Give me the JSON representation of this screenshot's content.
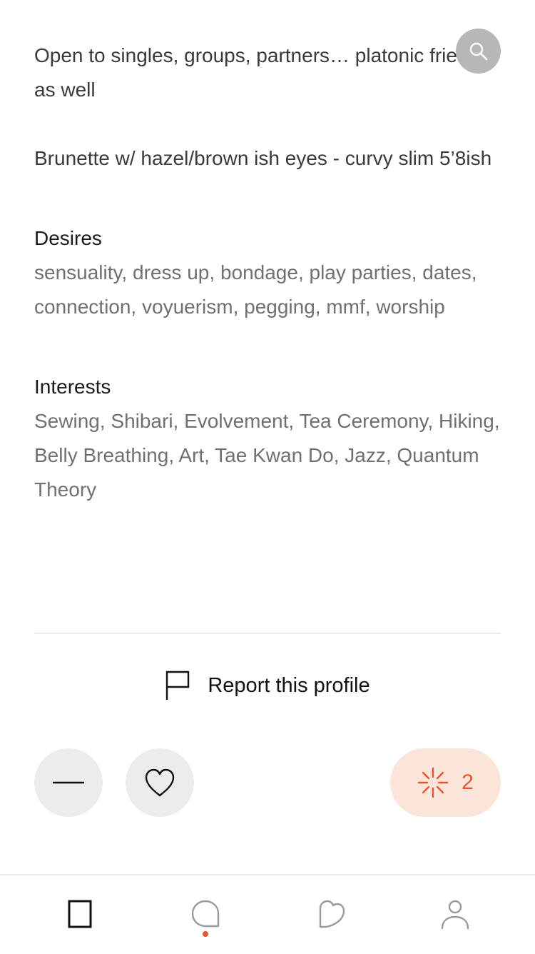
{
  "profile": {
    "bio_lines": [
      "Open to singles, groups, partners… platonic friends as well",
      "Brunette w/ hazel/brown ish eyes - curvy slim 5’8ish"
    ],
    "desires": {
      "title": "Desires",
      "text": "sensuality, dress up, bondage, play parties, dates, connection, voyuerism, pegging, mmf, worship"
    },
    "interests": {
      "title": "Interests",
      "text": "Sewing, Shibari, Evolvement, Tea Ceremony, Hiking, Belly Breathing, Art, Tae Kwan Do, Jazz, Quantum Theory"
    }
  },
  "actions": {
    "report_label": "Report this profile",
    "spark_count": "2"
  },
  "icons": {
    "search": "search-icon",
    "report": "flag-icon",
    "dismiss": "minus-icon",
    "like": "heart-icon",
    "spark": "spark-icon",
    "tabs": [
      "card-icon",
      "chat-bubble-icon",
      "heart-outline-icon",
      "person-icon"
    ]
  },
  "colors": {
    "accent": "#e4572e",
    "spark_bg": "#fbe4da",
    "button_bg": "#ececec",
    "search_bg": "#b7b7b7",
    "muted_text": "#707070"
  }
}
